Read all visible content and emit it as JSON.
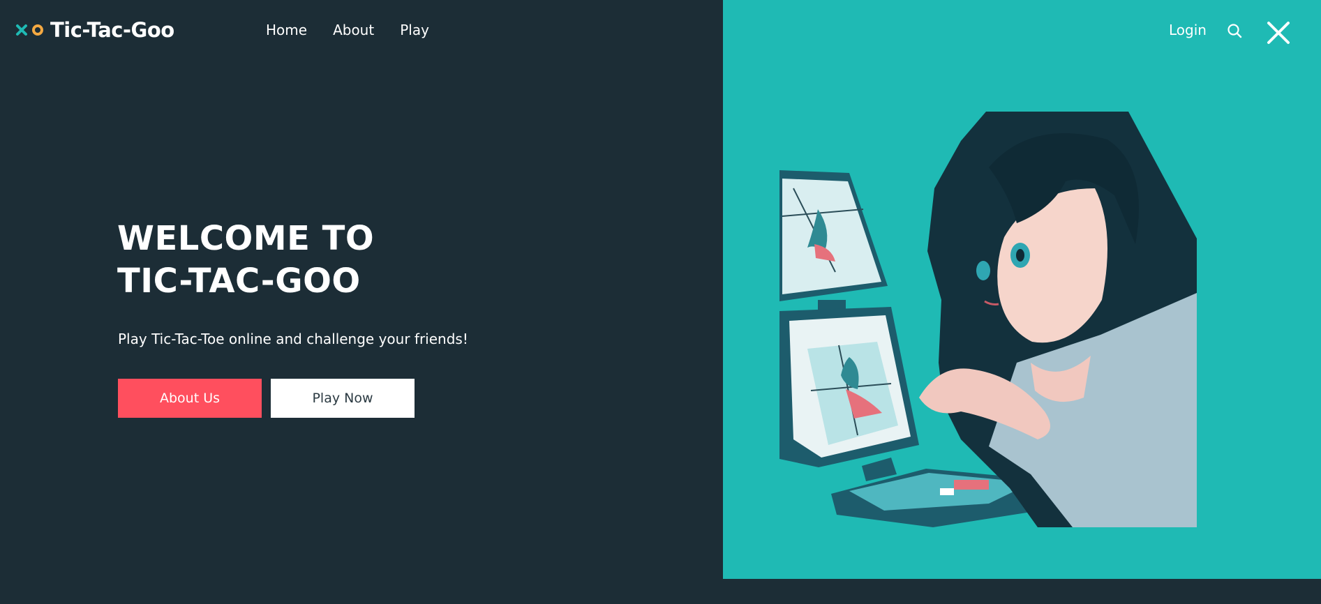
{
  "brand": {
    "name": "Tic-Tac-Goo",
    "x_color": "#1fbab4",
    "o_color": "#f4a942"
  },
  "nav": {
    "items": [
      {
        "label": "Home"
      },
      {
        "label": "About"
      },
      {
        "label": "Play"
      }
    ]
  },
  "header_right": {
    "login_label": "Login",
    "search_icon": "search-icon",
    "close_icon": "close-icon"
  },
  "hero": {
    "title_line1": "WELCOME TO",
    "title_line2": "TIC-TAC-GOO",
    "subtitle": "Play Tic-Tac-Toe online and challenge your friends!",
    "about_button_label": "About Us",
    "play_button_label": "Play Now"
  },
  "colors": {
    "background": "#1c2d36",
    "accent_panel": "#1fbab4",
    "primary_button": "#ff4f5e",
    "secondary_button": "#ffffff"
  }
}
